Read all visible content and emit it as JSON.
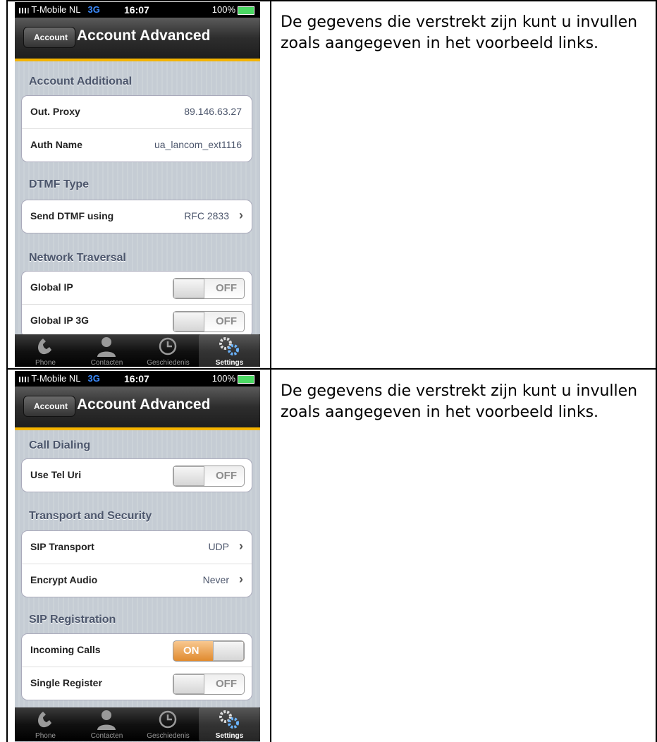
{
  "rows": [
    {
      "text": "De gegevens die verstrekt zijn kunt u invullen zoals aangegeven in het voorbeeld links.",
      "phone": {
        "status": {
          "carrier": "T-Mobile NL",
          "network": "3G",
          "time": "16:07",
          "battery": "100%"
        },
        "nav": {
          "back": "Account",
          "title": "Account Advanced"
        },
        "sections": [
          {
            "header": "Account Additional",
            "items": [
              {
                "label": "Out. Proxy",
                "value": "89.146.63.27"
              },
              {
                "label": "Auth Name",
                "value": "ua_lancom_ext1116"
              }
            ]
          },
          {
            "header": "DTMF Type",
            "items": [
              {
                "label": "Send DTMF using",
                "value": "RFC 2833"
              }
            ]
          },
          {
            "header": "Network Traversal",
            "items": [
              {
                "label": "Global IP",
                "switch": "OFF"
              },
              {
                "label": "Global IP 3G",
                "switch": "OFF"
              }
            ]
          }
        ],
        "tabs": [
          "Phone",
          "Contacten",
          "Geschiedenis",
          "Settings"
        ]
      }
    },
    {
      "text": "De gegevens die verstrekt zijn kunt u invullen zoals aangegeven in het voorbeeld links.",
      "phone": {
        "status": {
          "carrier": "T-Mobile NL",
          "network": "3G",
          "time": "16:07",
          "battery": "100%"
        },
        "nav": {
          "back": "Account",
          "title": "Account Advanced"
        },
        "sections": [
          {
            "header": "Call Dialing",
            "items": [
              {
                "label": "Use Tel Uri",
                "switch": "OFF"
              }
            ]
          },
          {
            "header": "Transport and Security",
            "items": [
              {
                "label": "SIP Transport",
                "value": "UDP"
              },
              {
                "label": "Encrypt Audio",
                "value": "Never"
              }
            ]
          },
          {
            "header": "SIP Registration",
            "items": [
              {
                "label": "Incoming Calls",
                "switch": "ON"
              },
              {
                "label": "Single Register",
                "switch": "OFF"
              }
            ]
          }
        ],
        "tabs": [
          "Phone",
          "Contacten",
          "Geschiedenis",
          "Settings"
        ]
      }
    }
  ]
}
